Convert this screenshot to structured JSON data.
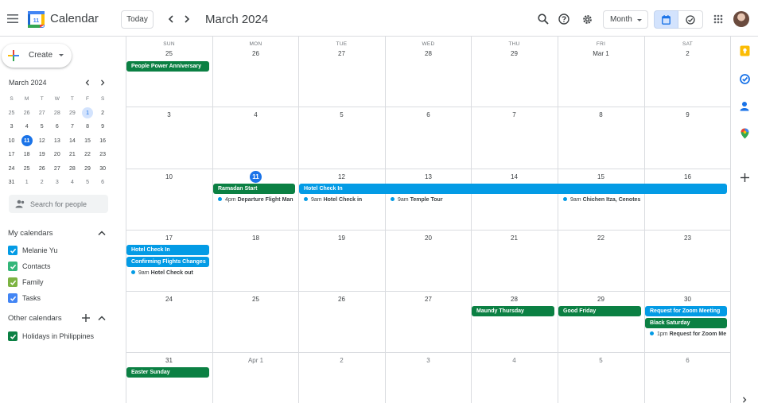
{
  "app": {
    "title": "Calendar",
    "logo_day": "11"
  },
  "header": {
    "today_label": "Today",
    "month_title": "March 2024",
    "view_label": "Month"
  },
  "sidebar": {
    "create_label": "Create",
    "mini_calendar": {
      "title": "March 2024",
      "weekdays": [
        "S",
        "M",
        "T",
        "W",
        "T",
        "F",
        "S"
      ],
      "weeks": [
        [
          {
            "d": "25",
            "m": true
          },
          {
            "d": "26",
            "m": true
          },
          {
            "d": "27",
            "m": true
          },
          {
            "d": "28",
            "m": true
          },
          {
            "d": "29",
            "m": true
          },
          {
            "d": "1",
            "s": true
          },
          {
            "d": "2"
          }
        ],
        [
          {
            "d": "3"
          },
          {
            "d": "4"
          },
          {
            "d": "5"
          },
          {
            "d": "6"
          },
          {
            "d": "7"
          },
          {
            "d": "8"
          },
          {
            "d": "9"
          }
        ],
        [
          {
            "d": "10"
          },
          {
            "d": "11",
            "t": true
          },
          {
            "d": "12"
          },
          {
            "d": "13"
          },
          {
            "d": "14"
          },
          {
            "d": "15"
          },
          {
            "d": "16"
          }
        ],
        [
          {
            "d": "17"
          },
          {
            "d": "18"
          },
          {
            "d": "19"
          },
          {
            "d": "20"
          },
          {
            "d": "21"
          },
          {
            "d": "22"
          },
          {
            "d": "23"
          }
        ],
        [
          {
            "d": "24"
          },
          {
            "d": "25"
          },
          {
            "d": "26"
          },
          {
            "d": "27"
          },
          {
            "d": "28"
          },
          {
            "d": "29"
          },
          {
            "d": "30"
          }
        ],
        [
          {
            "d": "31"
          },
          {
            "d": "1",
            "m": true
          },
          {
            "d": "2",
            "m": true
          },
          {
            "d": "3",
            "m": true
          },
          {
            "d": "4",
            "m": true
          },
          {
            "d": "5",
            "m": true
          },
          {
            "d": "6",
            "m": true
          }
        ]
      ]
    },
    "search_people_placeholder": "Search for people",
    "my_calendars_title": "My calendars",
    "my_calendars": [
      {
        "label": "Melanie Yu",
        "color": "#039be5"
      },
      {
        "label": "Contacts",
        "color": "#33b679"
      },
      {
        "label": "Family",
        "color": "#7cb342"
      },
      {
        "label": "Tasks",
        "color": "#4285f4"
      }
    ],
    "other_calendars_title": "Other calendars",
    "other_calendars": [
      {
        "label": "Holidays in Philippines",
        "color": "#0b8043"
      }
    ]
  },
  "grid": {
    "weekdays": [
      "SUN",
      "MON",
      "TUE",
      "WED",
      "THU",
      "FRI",
      "SAT"
    ],
    "weeks": [
      {
        "days": [
          {
            "n": "25"
          },
          {
            "n": "26"
          },
          {
            "n": "27"
          },
          {
            "n": "28"
          },
          {
            "n": "29"
          },
          {
            "n": "Mar 1"
          },
          {
            "n": "2"
          }
        ],
        "chips": [
          {
            "title": "People Power Anniversary",
            "start": 0,
            "span": 1,
            "row": 0,
            "color": "green"
          }
        ],
        "timed": []
      },
      {
        "days": [
          {
            "n": "3"
          },
          {
            "n": "4"
          },
          {
            "n": "5"
          },
          {
            "n": "6"
          },
          {
            "n": "7"
          },
          {
            "n": "8"
          },
          {
            "n": "9"
          }
        ],
        "chips": [],
        "timed": []
      },
      {
        "days": [
          {
            "n": "10"
          },
          {
            "n": "11",
            "today": true
          },
          {
            "n": "12"
          },
          {
            "n": "13"
          },
          {
            "n": "14"
          },
          {
            "n": "15"
          },
          {
            "n": "16"
          }
        ],
        "chips": [
          {
            "title": "Ramadan Start",
            "start": 1,
            "span": 1,
            "row": 0,
            "color": "green"
          },
          {
            "title": "Hotel Check In",
            "start": 2,
            "span": 5,
            "row": 0,
            "color": "blue"
          }
        ],
        "timed": [
          {
            "day": 1,
            "row": 1,
            "time": "4pm",
            "title": "Departure Flight Man"
          },
          {
            "day": 2,
            "row": 1,
            "time": "9am",
            "title": "Hotel Check in"
          },
          {
            "day": 3,
            "row": 1,
            "time": "9am",
            "title": "Temple Tour"
          },
          {
            "day": 5,
            "row": 1,
            "time": "9am",
            "title": "Chichen Itza, Cenotes"
          }
        ]
      },
      {
        "days": [
          {
            "n": "17"
          },
          {
            "n": "18"
          },
          {
            "n": "19"
          },
          {
            "n": "20"
          },
          {
            "n": "21"
          },
          {
            "n": "22"
          },
          {
            "n": "23"
          }
        ],
        "chips": [
          {
            "title": "Hotel Check In",
            "start": 0,
            "span": 1,
            "row": 0,
            "color": "blue"
          },
          {
            "title": "Confirming Flights Changes",
            "start": 0,
            "span": 1,
            "row": 1,
            "color": "blue"
          }
        ],
        "timed": [
          {
            "day": 0,
            "row": 2,
            "time": "9am",
            "title": "Hotel Check out"
          }
        ]
      },
      {
        "days": [
          {
            "n": "24"
          },
          {
            "n": "25"
          },
          {
            "n": "26"
          },
          {
            "n": "27"
          },
          {
            "n": "28"
          },
          {
            "n": "29"
          },
          {
            "n": "30"
          }
        ],
        "chips": [
          {
            "title": "Maundy Thursday",
            "start": 4,
            "span": 1,
            "row": 0,
            "color": "green"
          },
          {
            "title": "Good Friday",
            "start": 5,
            "span": 1,
            "row": 0,
            "color": "green"
          },
          {
            "title": "Request for Zoom Meeting",
            "start": 6,
            "span": 1,
            "row": 0,
            "color": "blue"
          },
          {
            "title": "Black Saturday",
            "start": 6,
            "span": 1,
            "row": 1,
            "color": "green"
          }
        ],
        "timed": [
          {
            "day": 6,
            "row": 2,
            "time": "1pm",
            "title": "Request for Zoom Me"
          }
        ]
      },
      {
        "days": [
          {
            "n": "31"
          },
          {
            "n": "Apr 1",
            "muted": true
          },
          {
            "n": "2",
            "muted": true
          },
          {
            "n": "3",
            "muted": true
          },
          {
            "n": "4",
            "muted": true
          },
          {
            "n": "5",
            "muted": true
          },
          {
            "n": "6",
            "muted": true
          }
        ],
        "chips": [
          {
            "title": "Easter Sunday",
            "start": 0,
            "span": 1,
            "row": 0,
            "color": "green"
          }
        ],
        "timed": []
      }
    ]
  },
  "colors": {
    "accent": "#1a73e8",
    "holiday_green": "#0b8043",
    "event_blue": "#039be5"
  },
  "rail_icons": [
    "keep-icon",
    "tasks-icon",
    "contacts-icon",
    "maps-icon",
    "add-icon"
  ]
}
